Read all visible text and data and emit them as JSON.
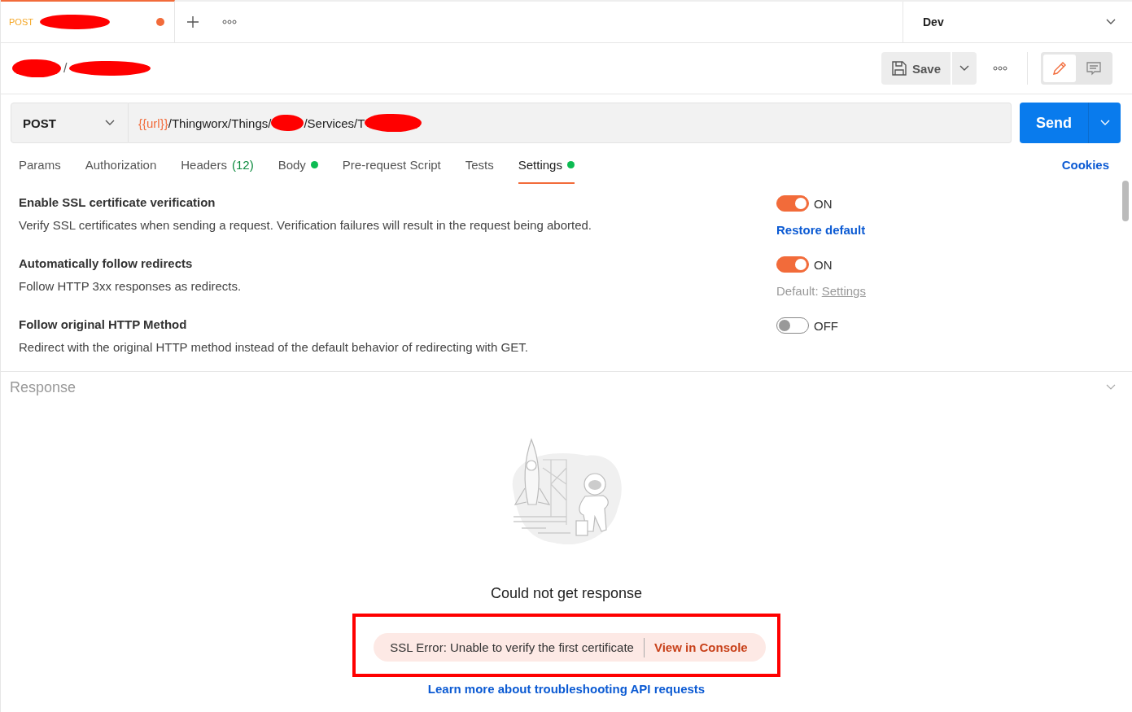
{
  "request_tab": {
    "method": "POST",
    "name_redacted": true,
    "unsaved": true,
    "selected": true
  },
  "environment": {
    "label": "Dev"
  },
  "breadcrumb": {
    "separator": "/",
    "items": [
      {
        "redacted": true
      },
      {
        "redacted": true
      }
    ]
  },
  "toolbar": {
    "save_label": "Save",
    "mode": [
      {
        "kind": "edit",
        "selected": true
      },
      {
        "kind": "comments",
        "selected": false
      }
    ]
  },
  "request": {
    "method": "POST",
    "url": [
      {
        "kind": "variable",
        "text": "{{url}}"
      },
      {
        "kind": "plain",
        "text": "/Thingworx/Things/"
      },
      {
        "kind": "redaction"
      },
      {
        "kind": "plain",
        "text": "/Services/T"
      },
      {
        "kind": "redaction"
      }
    ],
    "send_label": "Send"
  },
  "tabs": [
    {
      "label": "Params",
      "selected": false
    },
    {
      "label": "Authorization",
      "selected": false
    },
    {
      "label": "Headers",
      "count": "(12)",
      "selected": false
    },
    {
      "label": "Body",
      "dot": true,
      "selected": false
    },
    {
      "label": "Pre-request Script",
      "selected": false
    },
    {
      "label": "Tests",
      "selected": false
    },
    {
      "label": "Settings",
      "dot": true,
      "selected": true
    }
  ],
  "cookies_label": "Cookies",
  "settings": [
    {
      "title": "Enable SSL certificate verification",
      "description": "Verify SSL certificates when sending a request. Verification failures will result in the request being aborted.",
      "on": true,
      "state_label": "ON",
      "note": {
        "kind": "link",
        "text": "Restore default"
      }
    },
    {
      "title": "Automatically follow redirects",
      "description": "Follow HTTP 3xx responses as redirects.",
      "on": true,
      "state_label": "ON",
      "note": {
        "kind": "default",
        "prefix": "Default:",
        "link": "Settings"
      }
    },
    {
      "title": "Follow original HTTP Method",
      "description": "Redirect with the original HTTP method instead of the default behavior of redirecting with GET.",
      "on": false,
      "state_label": "OFF"
    }
  ],
  "response": {
    "title": "Response",
    "message": "Could not get response",
    "error": {
      "text": "SSL Error: Unable to verify the first certificate",
      "action": "View in Console",
      "highlighted": true
    },
    "help_link": "Learn more about troubleshooting API requests"
  }
}
